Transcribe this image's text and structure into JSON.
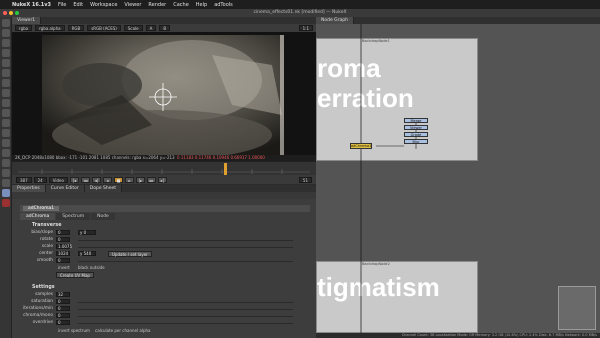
{
  "menubar": {
    "app": "NukeX 16.1v3",
    "items": [
      "File",
      "Edit",
      "Workspace",
      "Viewer",
      "Render",
      "Cache",
      "Help",
      "adTools"
    ]
  },
  "window": {
    "title": "cinema_effects01.nk [modified] — NukeX"
  },
  "viewer": {
    "tab": "Viewer1",
    "controls": [
      "rgba",
      "rgba.alpha",
      "RGB",
      "sRGB (ACES)",
      "Scale",
      "A",
      "B"
    ],
    "zoom": "1:1",
    "info": "2K_DCP 2048x1080  bbox: -171 -101 2081 1085  channels: rgba  x=2064 y=-213",
    "pixel_values": "0.11183 0.11746 0.10946 0.66917 1.00000",
    "format": "2K_DCP",
    "frame": "387",
    "fps": "24",
    "mode": "Video",
    "end_frame": "51"
  },
  "properties": {
    "tabs": [
      "Properties",
      "Curve Editor",
      "Dope Sheet"
    ],
    "node_name": "adChroma1",
    "node_tabs": [
      "adChroma",
      "Spectrum",
      "Node"
    ],
    "section_transverse": "Transverse",
    "rows": [
      {
        "label": "bias/slope",
        "val": "0",
        "extra": "y 0"
      },
      {
        "label": "rotate",
        "val": "0"
      },
      {
        "label": "scale",
        "val": "1.0075"
      },
      {
        "label": "center",
        "val": "1024",
        "extra": "y 540"
      },
      {
        "label": "smooth",
        "val": "0"
      }
    ],
    "center_button": "Update / set layer",
    "invert_label": "invert",
    "black_outside_label": "black outside",
    "create_button": "Create UV Map",
    "section_settings": "Settings",
    "settings_rows": [
      {
        "label": "samples",
        "val": "32"
      },
      {
        "label": "saturation",
        "val": "0"
      },
      {
        "label": "iterations/min",
        "val": "0"
      },
      {
        "label": "chroma/mono",
        "val": "0"
      },
      {
        "label": "overdrive",
        "val": "0"
      }
    ],
    "invert_spectrum": "invert spectrum",
    "per_channel_alpha": "calculate per channel alpha"
  },
  "nodegraph": {
    "tab": "Node Graph",
    "backdrop1_title": "roma\nerration",
    "backdrop1_label": "BackdropNode1",
    "backdrop2_title": "tigmatism",
    "backdrop2_label": "BackdropNode2",
    "node_main": "adChroma1",
    "nodes_small": [
      "Merge",
      "Viewer",
      "Grade",
      "Blur"
    ]
  },
  "statusbar": "Channel Count: 38  Localization Mode: Off  Memory: 3.2 GB (10.6%)  CPU: 2.4%  Disk: 6.7 MB/s  Network: 0.0 MB/s"
}
